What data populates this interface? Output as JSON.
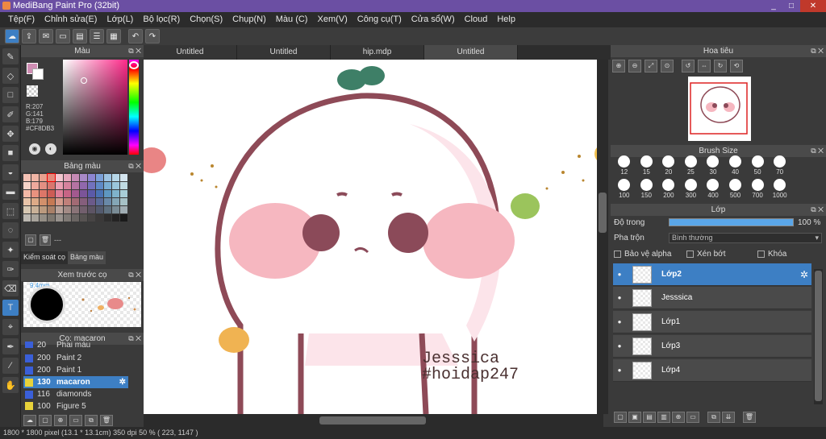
{
  "window": {
    "title": "MediBang Paint Pro (32bit)",
    "controls": [
      "_",
      "□",
      "✕"
    ]
  },
  "menu": [
    "Tệp(F)",
    "Chỉnh sửa(E)",
    "Lớp(L)",
    "Bộ lọc(R)",
    "Chọn(S)",
    "Chụp(N)",
    "Màu (C)",
    "Xem(V)",
    "Công cụ(T)",
    "Cửa sổ(W)",
    "Cloud",
    "Help"
  ],
  "doc_tabs": [
    "Untitled",
    "Untitled",
    "hip.mdp",
    "Untitled"
  ],
  "color_panel": {
    "title": "Màu",
    "r": "R:207",
    "g": "G:141",
    "b": "B:179",
    "hex": "#CF8DB3",
    "fg_color": "#cf8db3"
  },
  "palette_panel": {
    "title": "Bảng màu",
    "footer": "---",
    "swatches": [
      "#f4c2b5",
      "#f0b5a5",
      "#e8a18f",
      "#e28b7d",
      "#f2c6cf",
      "#e7a7bd",
      "#c58ab5",
      "#a889c7",
      "#8c85d1",
      "#7aa0d8",
      "#9cc3e3",
      "#b6d7e8",
      "#d4e5ef",
      "#f6d3c8",
      "#eea99c",
      "#e38f83",
      "#d9766e",
      "#ea9fb2",
      "#d5829d",
      "#b473a2",
      "#9068ac",
      "#7272bd",
      "#5f8ac6",
      "#7aaed3",
      "#9ac6db",
      "#c0dbe3",
      "#f3b8a6",
      "#e9927f",
      "#dd7668",
      "#cd5c55",
      "#df7f98",
      "#c76485",
      "#a3598f",
      "#7b5499",
      "#5b5aa8",
      "#4a72b3",
      "#5e97c1",
      "#7fb3cb",
      "#a8cdd6",
      "#e8c3a8",
      "#ddaa87",
      "#d2906b",
      "#c57954",
      "#d59b8c",
      "#c0807a",
      "#a26a74",
      "#855e7c",
      "#6b5a8a",
      "#5a6b98",
      "#6989a8",
      "#84a6b6",
      "#a6c1c6",
      "#d6c7b2",
      "#c9b198",
      "#bb9a7e",
      "#a88068",
      "#b9a39b",
      "#a38b86",
      "#8a7478",
      "#725f6d",
      "#5d5464",
      "#535a6e",
      "#5f7180",
      "#7a8c96",
      "#a0adb3",
      "#bcb8b1",
      "#a8a39b",
      "#948e85",
      "#7d776f",
      "#98928d",
      "#807a76",
      "#6a6563",
      "#575352",
      "#474444",
      "#3b3939",
      "#2f2e2e",
      "#242323",
      "#1a1a1a"
    ]
  },
  "panel_tabs": {
    "left": "Kiểm soát cọ",
    "right": "Bảng màu"
  },
  "brush_preview": {
    "title": "Xem trước cọ",
    "size": "9.4mm"
  },
  "brush_list": {
    "title": "Cọ: macaron",
    "items": [
      {
        "n": "20",
        "name": "Phai màu",
        "color": "#3a5fd8"
      },
      {
        "n": "200",
        "name": "Paint 2",
        "color": "#3a5fd8"
      },
      {
        "n": "200",
        "name": "Paint 1",
        "color": "#3a5fd8"
      },
      {
        "n": "130",
        "name": "macaron",
        "color": "#e8d23a"
      },
      {
        "n": "116",
        "name": "diamonds",
        "color": "#3a5fd8"
      },
      {
        "n": "100",
        "name": "Figure 5",
        "color": "#e8d23a"
      }
    ]
  },
  "navigator": {
    "title": "Hoa tiêu"
  },
  "brush_size": {
    "title": "Brush Size",
    "values": [
      "12",
      "15",
      "20",
      "25",
      "30",
      "40",
      "50",
      "70",
      "",
      "100",
      "150",
      "200",
      "300",
      "400",
      "500",
      "700",
      "1000",
      ""
    ]
  },
  "layers": {
    "title": "Lớp",
    "opacity_label": "Độ trong",
    "opacity_value": "100 %",
    "opacity_fraction": 1.0,
    "blend_label": "Pha trộn",
    "blend_value": "Bình thường",
    "alpha_label": "Bảo vệ alpha",
    "clip_label": "Xén bớt",
    "lock_label": "Khóa",
    "items": [
      "Lớp2",
      "Jesssica",
      "Lớp1",
      "Lớp3",
      "Lớp4"
    ]
  },
  "canvas": {
    "sig1": "Jesssica",
    "sig2": "#hoidap247"
  },
  "status": "1800 * 1800 pixel   (13.1 * 13.1cm)   350 dpi   50 %   ( 223, 1147 )"
}
